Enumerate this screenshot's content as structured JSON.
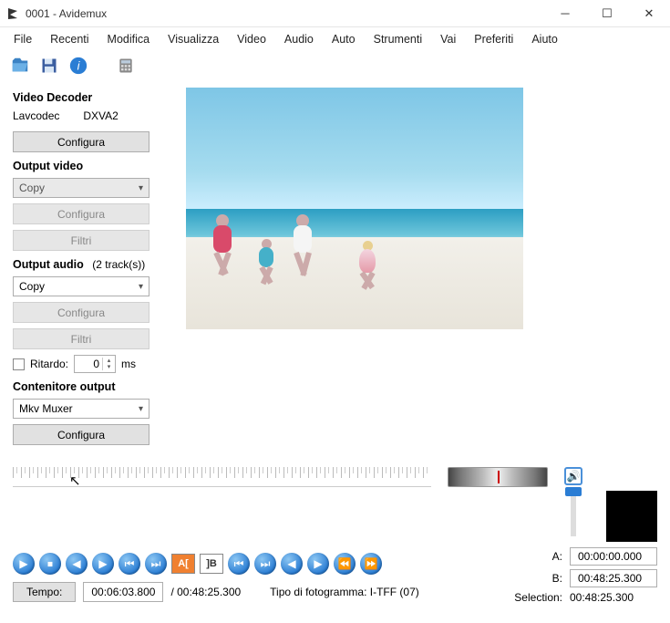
{
  "title": "0001 - Avidemux",
  "menu": [
    "File",
    "Recenti",
    "Modifica",
    "Visualizza",
    "Video",
    "Audio",
    "Auto",
    "Strumenti",
    "Vai",
    "Preferiti",
    "Aiuto"
  ],
  "videoDecoder": {
    "heading": "Video Decoder",
    "lib": "Lavcodec",
    "accel": "DXVA2",
    "configure": "Configura"
  },
  "outputVideo": {
    "heading": "Output video",
    "codec": "Copy",
    "configure": "Configura",
    "filters": "Filtri"
  },
  "outputAudio": {
    "heading": "Output audio",
    "tracks": "(2 track(s))",
    "codec": "Copy",
    "configure": "Configura",
    "filters": "Filtri",
    "delayLabel": "Ritardo:",
    "delayValue": "0",
    "delayUnit": "ms"
  },
  "container": {
    "heading": "Contenitore output",
    "muxer": "Mkv Muxer",
    "configure": "Configura"
  },
  "transport": {
    "timeLabel": "Tempo:",
    "current": "00:06:03.800",
    "total": "/ 00:48:25.300",
    "frameType": "Tipo di fotogramma:  I-TFF (07)"
  },
  "selection": {
    "aLabel": "A:",
    "aValue": "00:00:00.000",
    "bLabel": "B:",
    "bValue": "00:48:25.300",
    "selLabel": "Selection:",
    "selValue": "00:48:25.300"
  }
}
